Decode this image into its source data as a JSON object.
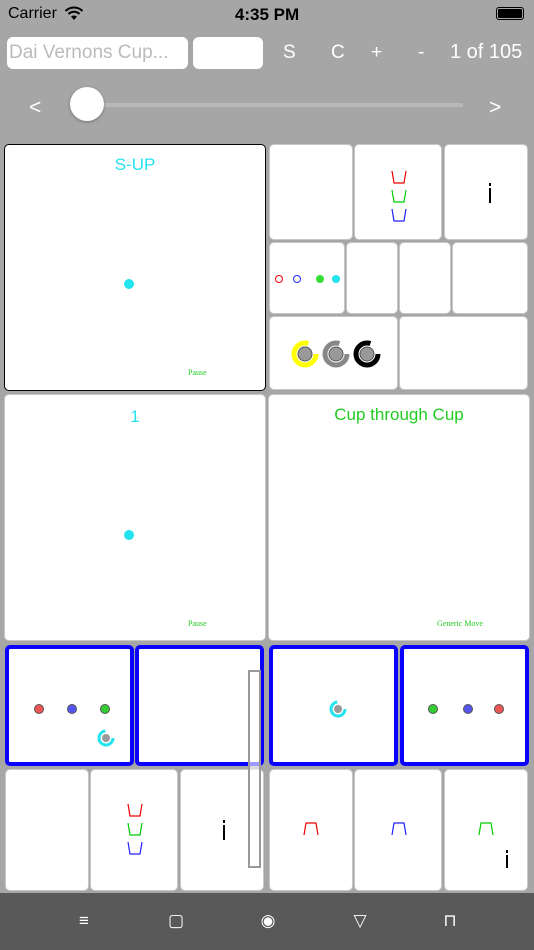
{
  "status": {
    "carrier": "Carrier",
    "time": "4:35 PM"
  },
  "toolbar": {
    "title_field": "Dai Vernons Cup...",
    "s_label": "S",
    "c_label": "C",
    "plus_label": "+",
    "minus_label": "-",
    "page_counter": "1 of 105"
  },
  "slider": {
    "prev_label": "<",
    "next_label": ">",
    "value": 0.0
  },
  "panels": {
    "sup": {
      "title": "S-UP",
      "footer": "Pause"
    },
    "one": {
      "title": "1",
      "footer": "Pause"
    },
    "cup": {
      "title": "Cup through Cup",
      "footer": "Generic Move"
    }
  },
  "nav": {
    "menu_icon": "≡",
    "square_icon": "▢",
    "circle_icon": "◉",
    "triangle_icon": "▽",
    "cup_icon": "⊓"
  },
  "colors": {
    "cyan": "#22e3ee",
    "green_text": "#22cc22",
    "blue_border": "#0a00ff"
  }
}
